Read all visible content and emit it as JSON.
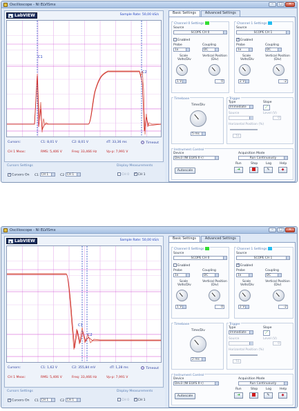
{
  "title": "Oscilloscope - NI ELVISmx",
  "logo": "LabVIEW",
  "sample_rate": "Sample Rate: 50,00 kS/s",
  "titlebar_controls": {
    "min": "–",
    "max": "□",
    "close": "✕"
  },
  "tabs": [
    "Basic Settings",
    "Advanced Settings"
  ],
  "ch0": {
    "title": "Channel 0 Settings",
    "color": "#33dd33",
    "source_label": "Source",
    "source": "SCOPE CH 0",
    "enabled_label": "Enabled",
    "enabled": false,
    "probe_label": "Probe",
    "probe": "1x",
    "coupling_label": "Coupling",
    "coupling": "DC",
    "scale_label": "Scale Volts/Div",
    "scale": "1 V",
    "vpos_label": "Vertical Position (Div)",
    "vpos": "0"
  },
  "ch1": {
    "title": "Channel 1 Settings",
    "color": "#22bbee",
    "source_label": "Source",
    "source": "SCOPE CH 1",
    "enabled_label": "Enabled",
    "enabled": true,
    "probe_label": "Probe",
    "probe": "1x",
    "coupling_label": "Coupling",
    "coupling": "DC",
    "scale_label": "Scale Volts/Div",
    "scale": "2 V",
    "vpos_label": "Vertical Position (Div)",
    "vpos": "-2"
  },
  "timebase": {
    "title": "Timebase",
    "label": "Time/Div"
  },
  "trigger": {
    "title": "Trigger",
    "type_label": "Type",
    "type": "Immediate",
    "slope_label": "Slope",
    "source_label": "Source",
    "level_label": "Level (V)",
    "level": "0",
    "hpos_label": "Horizontal Position (%)",
    "hpos": "51"
  },
  "instrument": {
    "title": "Instrument Control",
    "device_label": "Device",
    "device": "Dev3 (NI ELVIS II+)",
    "acq_label": "Acquisition Mode",
    "acq": "Run Continuously",
    "autoscale": "Autoscale",
    "run": "Run",
    "stop": "Stop",
    "log": "Log",
    "help": "Help"
  },
  "cursor_settings": {
    "title": "Cursors Settings",
    "cursors_on": "Cursors On",
    "c1_label": "C1",
    "c1": "CH 1",
    "c2_label": "C2",
    "c2": "CH 1"
  },
  "display_measurements": {
    "title": "Display Measurements",
    "ch0": "CH 0",
    "ch1": "CH 1"
  },
  "timeout": "Timeout",
  "panels": [
    {
      "cursors": "Cursors:",
      "c1_val": "C1: 8,01 V",
      "c2_val": "C2: 8,01 V",
      "dt": "dT: 33,36 ms",
      "ch_meas": "CH 1 Meas:",
      "rms": "RMS: 5,406 V",
      "freq": "Freq: 33,466 Hz",
      "vpp": "Vp-p: 7,991 V",
      "timediv": "5 ms",
      "cursor1_label": "C1",
      "cursor2_label": "C2"
    },
    {
      "cursors": "Cursors:",
      "c1_val": "C1: 1,62 V",
      "c2_val": "C2: 355,84 mV",
      "dt": "dT: 1,28 ms",
      "ch_meas": "CH 1 Meas:",
      "rms": "RMS: 5,406 V",
      "freq": "Freq: 33,466 Hz",
      "vpp": "Vp-p: 7,991 V",
      "timediv": "2 ms",
      "cursor1_label": "C1",
      "cursor2_label": "C2"
    }
  ]
}
